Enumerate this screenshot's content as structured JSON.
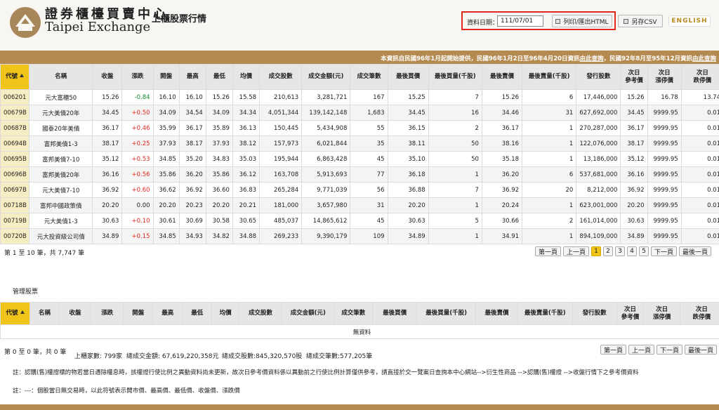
{
  "header": {
    "logo_cn": "證券櫃檯買賣中心",
    "logo_en": "Taipei Exchange",
    "page_title": "上櫃股票行情",
    "date_label": "資料日期：",
    "date_value": "111/07/01",
    "print_button": "列印/匯出HTML",
    "csv_button": "另存CSV",
    "english": "ENGLISH"
  },
  "notice": {
    "text1": "本資訊自民國96年1月起開始提供，民國96年1月2日至96年4月20日資訊",
    "link1": "由此查詢",
    "text2": "，民國92年8月至95年12月資訊",
    "link2": "由此查詢"
  },
  "columns": [
    "代號",
    "名稱",
    "收盤",
    "漲跌",
    "開盤",
    "最高",
    "最低",
    "均價",
    "成交股數",
    "成交金額(元)",
    "成交筆數",
    "最後買價",
    "最後買量(千股)",
    "最後賣價",
    "最後賣量(千股)",
    "發行股數",
    "次日\n參考價",
    "次日\n漲停價",
    "次日\n跌停價"
  ],
  "rows": [
    {
      "code": "006201",
      "name": "元大富櫃50",
      "close": "15.26",
      "chg": "-0.84",
      "dir": "down",
      "open": "16.10",
      "high": "16.10",
      "low": "15.26",
      "avg": "15.58",
      "vol": "210,613",
      "amt": "3,281,721",
      "trades": "167",
      "bid": "15.25",
      "bidvol": "7",
      "ask": "15.26",
      "askvol": "6",
      "shares": "17,446,000",
      "ref": "15.26",
      "up": "16.78",
      "dn": "13.74"
    },
    {
      "code": "00679B",
      "name": "元大美債20年",
      "close": "34.45",
      "chg": "+0.50",
      "dir": "up",
      "open": "34.09",
      "high": "34.54",
      "low": "34.09",
      "avg": "34.34",
      "vol": "4,051,344",
      "amt": "139,142,148",
      "trades": "1,683",
      "bid": "34.45",
      "bidvol": "16",
      "ask": "34.46",
      "askvol": "31",
      "shares": "627,692,000",
      "ref": "34.45",
      "up": "9999.95",
      "dn": "0.01"
    },
    {
      "code": "00687B",
      "name": "國泰20年美債",
      "close": "36.17",
      "chg": "+0.46",
      "dir": "up",
      "open": "35.99",
      "high": "36.17",
      "low": "35.89",
      "avg": "36.13",
      "vol": "150,445",
      "amt": "5,434,908",
      "trades": "55",
      "bid": "36.15",
      "bidvol": "2",
      "ask": "36.17",
      "askvol": "1",
      "shares": "270,287,000",
      "ref": "36.17",
      "up": "9999.95",
      "dn": "0.01"
    },
    {
      "code": "00694B",
      "name": "富邦美債1-3",
      "close": "38.17",
      "chg": "+0.25",
      "dir": "up",
      "open": "37.93",
      "high": "38.17",
      "low": "37.93",
      "avg": "38.12",
      "vol": "157,973",
      "amt": "6,021,844",
      "trades": "35",
      "bid": "38.11",
      "bidvol": "50",
      "ask": "38.16",
      "askvol": "1",
      "shares": "122,076,000",
      "ref": "38.17",
      "up": "9999.95",
      "dn": "0.01"
    },
    {
      "code": "00695B",
      "name": "富邦美債7-10",
      "close": "35.12",
      "chg": "+0.53",
      "dir": "up",
      "open": "34.85",
      "high": "35.20",
      "low": "34.83",
      "avg": "35.03",
      "vol": "195,944",
      "amt": "6,863,428",
      "trades": "45",
      "bid": "35.10",
      "bidvol": "50",
      "ask": "35.18",
      "askvol": "1",
      "shares": "13,186,000",
      "ref": "35.12",
      "up": "9999.95",
      "dn": "0.01"
    },
    {
      "code": "00696B",
      "name": "富邦美債20年",
      "close": "36.16",
      "chg": "+0.56",
      "dir": "up",
      "open": "35.86",
      "high": "36.20",
      "low": "35.86",
      "avg": "36.12",
      "vol": "163,708",
      "amt": "5,913,693",
      "trades": "77",
      "bid": "36.18",
      "bidvol": "1",
      "ask": "36.20",
      "askvol": "6",
      "shares": "537,681,000",
      "ref": "36.16",
      "up": "9999.95",
      "dn": "0.01"
    },
    {
      "code": "00697B",
      "name": "元大美債7-10",
      "close": "36.92",
      "chg": "+0.60",
      "dir": "up",
      "open": "36.62",
      "high": "36.92",
      "low": "36.60",
      "avg": "36.83",
      "vol": "265,284",
      "amt": "9,771,039",
      "trades": "56",
      "bid": "36.88",
      "bidvol": "7",
      "ask": "36.92",
      "askvol": "20",
      "shares": "8,212,000",
      "ref": "36.92",
      "up": "9999.95",
      "dn": "0.01"
    },
    {
      "code": "00718B",
      "name": "富邦中國政策債",
      "close": "20.20",
      "chg": "0.00",
      "dir": "flat",
      "open": "20.20",
      "high": "20.23",
      "low": "20.20",
      "avg": "20.21",
      "vol": "181,000",
      "amt": "3,657,980",
      "trades": "31",
      "bid": "20.20",
      "bidvol": "1",
      "ask": "20.24",
      "askvol": "1",
      "shares": "623,001,000",
      "ref": "20.20",
      "up": "9999.95",
      "dn": "0.01"
    },
    {
      "code": "00719B",
      "name": "元大美債1-3",
      "close": "30.63",
      "chg": "+0.10",
      "dir": "up",
      "open": "30.61",
      "high": "30.69",
      "low": "30.58",
      "avg": "30.65",
      "vol": "485,037",
      "amt": "14,865,612",
      "trades": "45",
      "bid": "30.63",
      "bidvol": "5",
      "ask": "30.66",
      "askvol": "2",
      "shares": "161,014,000",
      "ref": "30.63",
      "up": "9999.95",
      "dn": "0.01"
    },
    {
      "code": "00720B",
      "name": "元大投資級公司債",
      "close": "34.89",
      "chg": "+0.15",
      "dir": "up",
      "open": "34.85",
      "high": "34.93",
      "low": "34.82",
      "avg": "34.88",
      "vol": "269,233",
      "amt": "9,390,179",
      "trades": "109",
      "bid": "34.89",
      "bidvol": "1",
      "ask": "34.91",
      "askvol": "1",
      "shares": "894,109,000",
      "ref": "34.89",
      "up": "9999.95",
      "dn": "0.01"
    }
  ],
  "main_info": "第 1 至 10 筆，共 7,747 筆",
  "pager": {
    "first": "第一頁",
    "prev": "上一頁",
    "pages": [
      "1",
      "2",
      "3",
      "4",
      "5"
    ],
    "next": "下一頁",
    "last": "最後一頁"
  },
  "mgmt": {
    "title": "管理股票",
    "empty": "無資料",
    "info": "第 0 至 0 筆，共 0 筆"
  },
  "summary": {
    "count": "上櫃家數: 799家",
    "amount": "總成交金額: 67,619,220,358元",
    "volume": "總成交股數:845,320,570股",
    "trades": "總成交筆數:577,205筆"
  },
  "notes": {
    "note1": "註：認購(售)權證標的物若當日遇除權息時，該權證行使比例之異動資料尚未更新，故次日參考價資料係以異動前之行使比例計算僅供參考，請直接於交一覽案日查詢本中心網站-->衍生性商品 -->認購(售)權證 -->收盤行情下之參考價資料",
    "note2": "註：---：個股當日無交易時，以此符號表示開市價、最高價、最低價、收盤價、漲跌價"
  },
  "colors": {
    "accent": "#b58a50",
    "sorted": "#f0c419",
    "up": "#e0261d",
    "down": "#0d8a2a",
    "highlight": "#e0261d"
  }
}
